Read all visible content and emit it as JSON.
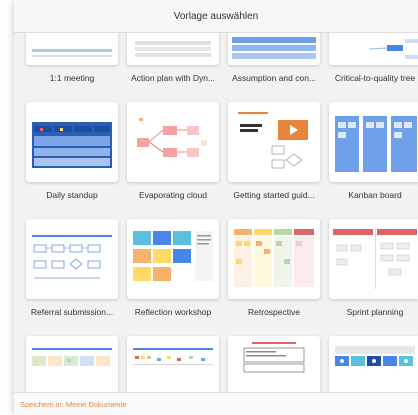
{
  "dialog": {
    "title": "Vorlage auswählen",
    "footer_text": "Speichern in: Meine Dokumente"
  },
  "templates": [
    {
      "label": "1:1 meeting",
      "icon": "1-1-meeting-thumbnail"
    },
    {
      "label": "Action plan with Dyn...",
      "icon": "action-plan-thumbnail"
    },
    {
      "label": "Assumption and con...",
      "icon": "assumption-thumbnail"
    },
    {
      "label": "Critical-to-quality tree",
      "icon": "ctq-tree-thumbnail"
    },
    {
      "label": "Daily standup",
      "icon": "daily-standup-thumbnail"
    },
    {
      "label": "Evaporating cloud",
      "icon": "evaporating-cloud-thumbnail"
    },
    {
      "label": "Getting started guid...",
      "icon": "getting-started-thumbnail"
    },
    {
      "label": "Kanban board",
      "icon": "kanban-board-thumbnail"
    },
    {
      "label": "Referral submission...",
      "icon": "referral-thumbnail"
    },
    {
      "label": "Reflection workshop",
      "icon": "reflection-workshop-thumbnail"
    },
    {
      "label": "Retrospective",
      "icon": "retrospective-thumbnail"
    },
    {
      "label": "Sprint planning",
      "icon": "sprint-planning-thumbnail"
    },
    {
      "label": "",
      "icon": "template-13-thumbnail"
    },
    {
      "label": "",
      "icon": "template-14-thumbnail"
    },
    {
      "label": "",
      "icon": "template-15-thumbnail"
    },
    {
      "label": "",
      "icon": "template-16-thumbnail"
    }
  ],
  "colors": {
    "accent": "#e8843c",
    "blue": "#4a86e8",
    "dark_blue": "#1f4e9e"
  }
}
